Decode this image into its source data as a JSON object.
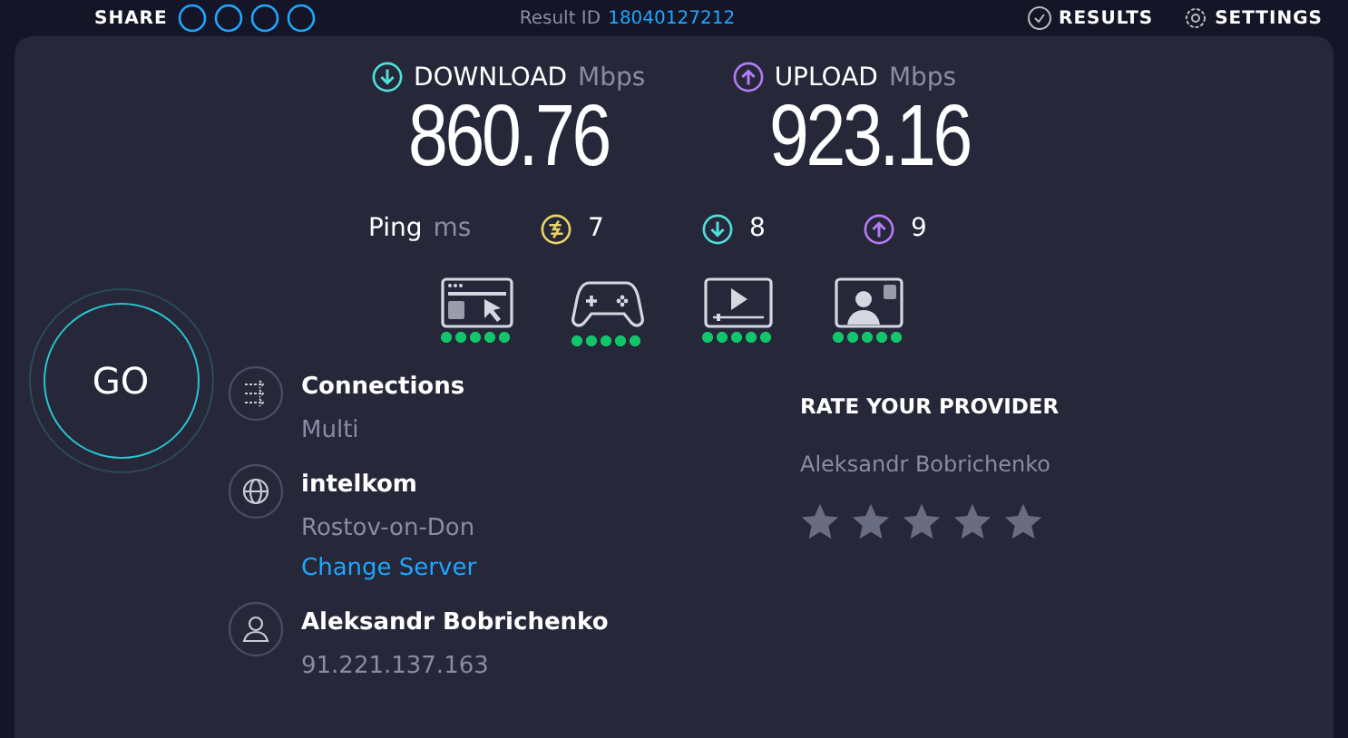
{
  "top_bar": {
    "share_label": "SHARE",
    "result_label": "Result ID",
    "result_id": "18040127212",
    "results": "RESULTS",
    "settings": "SETTINGS"
  },
  "download": {
    "label": "DOWNLOAD",
    "unit": "Mbps",
    "value": "860.76"
  },
  "upload": {
    "label": "UPLOAD",
    "unit": "Mbps",
    "value": "923.16"
  },
  "ping": {
    "label": "Ping",
    "unit": "ms",
    "values": [
      {
        "kind": "idle",
        "value": "7"
      },
      {
        "kind": "download",
        "value": "8"
      },
      {
        "kind": "upload",
        "value": "9"
      }
    ]
  },
  "quality": [
    {
      "kind": "browsing",
      "level": 1
    },
    {
      "kind": "gaming",
      "level": 1
    },
    {
      "kind": "streaming",
      "level": 1
    },
    {
      "kind": "video_call",
      "level": 1
    }
  ],
  "go_button": "GO",
  "info": [
    {
      "kind": "connections",
      "title": "Connections",
      "subtitle": "Multi"
    },
    {
      "kind": "server",
      "title": "intelkom",
      "subtitle": "Rostov-on-Don",
      "link": "Change Server"
    },
    {
      "kind": "user",
      "title": "Aleksandr Bobrichenko",
      "subtitle": "91.221.137.163"
    }
  ],
  "rating": {
    "title": "RATE YOUR PROVIDER",
    "provider": "Aleksandr Bobrichenko"
  }
}
